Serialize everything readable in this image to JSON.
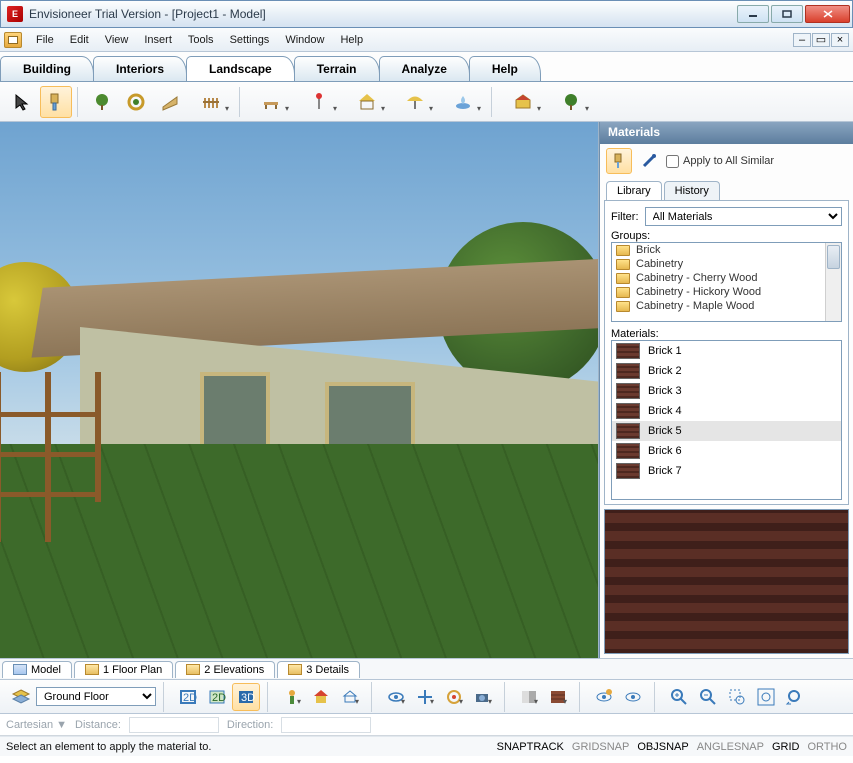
{
  "window": {
    "title": "Envisioneer Trial Version - [Project1 - Model]"
  },
  "menu": [
    "File",
    "Edit",
    "View",
    "Insert",
    "Tools",
    "Settings",
    "Window",
    "Help"
  ],
  "ribbon": {
    "tabs": [
      "Building",
      "Interiors",
      "Landscape",
      "Terrain",
      "Analyze",
      "Help"
    ],
    "active": 2
  },
  "toolbar_icons": [
    "pointer",
    "brush",
    "tree",
    "bush",
    "path",
    "fence",
    "bench",
    "pole",
    "gazebo",
    "umbrella",
    "fountain",
    "shed",
    "tree2"
  ],
  "viewtabs": [
    {
      "label": "Model",
      "kind": "model"
    },
    {
      "label": "1 Floor Plan",
      "kind": "folder"
    },
    {
      "label": "2 Elevations",
      "kind": "folder"
    },
    {
      "label": "3 Details",
      "kind": "folder"
    }
  ],
  "bottombar": {
    "floor_select": "Ground Floor"
  },
  "coord": {
    "mode": "Cartesian",
    "distance_label": "Distance:",
    "direction_label": "Direction:"
  },
  "status": {
    "message": "Select an element to apply the material to.",
    "toggles": [
      {
        "label": "SNAPTRACK",
        "on": true
      },
      {
        "label": "GRIDSNAP",
        "on": false
      },
      {
        "label": "OBJSNAP",
        "on": true
      },
      {
        "label": "ANGLESNAP",
        "on": false
      },
      {
        "label": "GRID",
        "on": true
      },
      {
        "label": "ORTHO",
        "on": false
      }
    ]
  },
  "materials": {
    "panel_title": "Materials",
    "apply_similar": "Apply to All Similar",
    "tabs": [
      "Library",
      "History"
    ],
    "active_tab": 0,
    "filter_label": "Filter:",
    "filter_value": "All Materials",
    "groups_label": "Groups:",
    "groups": [
      "Brick",
      "Cabinetry",
      "Cabinetry - Cherry Wood",
      "Cabinetry - Hickory Wood",
      "Cabinetry - Maple Wood"
    ],
    "materials_label": "Materials:",
    "list": [
      "Brick 1",
      "Brick 2",
      "Brick 3",
      "Brick 4",
      "Brick 5",
      "Brick 6",
      "Brick 7"
    ],
    "selected_index": 4,
    "swatch_colors": [
      "#6a4a3c",
      "#6e4b32",
      "#6e2f25",
      "#6e2f25",
      "#5a2c23",
      "#4d2820",
      "#4d2820"
    ]
  },
  "colors": {
    "titlebar": "#d5e3f1",
    "accent": "#5c7d9e",
    "selection": "#ffe0a3"
  }
}
